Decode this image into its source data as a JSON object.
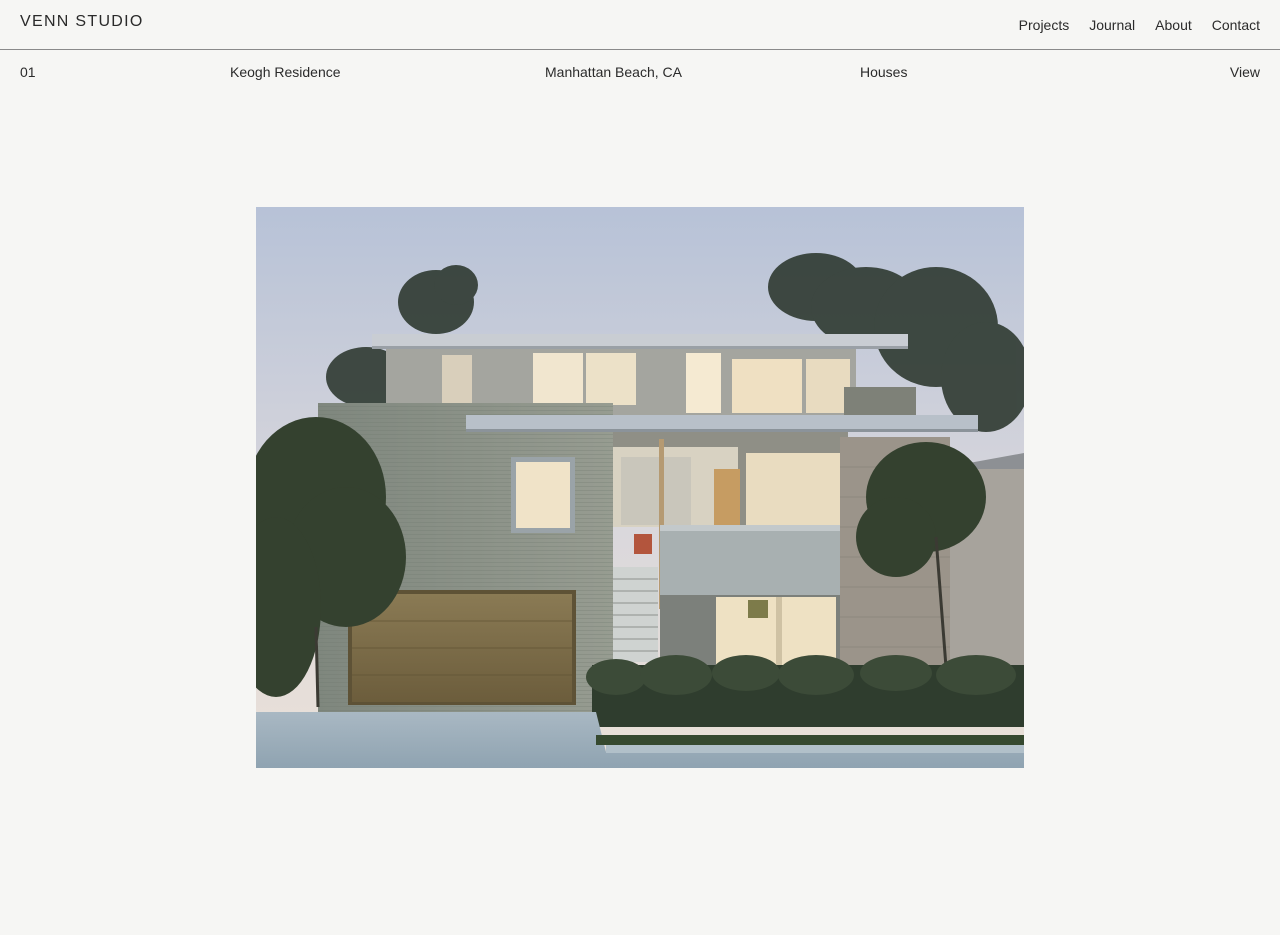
{
  "header": {
    "logo": "VENN STUDIO",
    "nav": [
      "Projects",
      "Journal",
      "About",
      "Contact"
    ]
  },
  "project": {
    "number": "01",
    "name": "Keogh Residence",
    "location": "Manhattan Beach, CA",
    "category": "Houses",
    "view_label": "View"
  },
  "image": {
    "subject": "modern-house-exterior-dusk-photo",
    "colors": {
      "sky_top": "#b9c3d6",
      "sky_bottom": "#e7ddd6",
      "wall": "#8c9288",
      "garage": "#7a6a45",
      "glass_warm": "#f2e3c4",
      "foliage": "#3e4a3a",
      "pavement": "#9fb1be"
    }
  }
}
